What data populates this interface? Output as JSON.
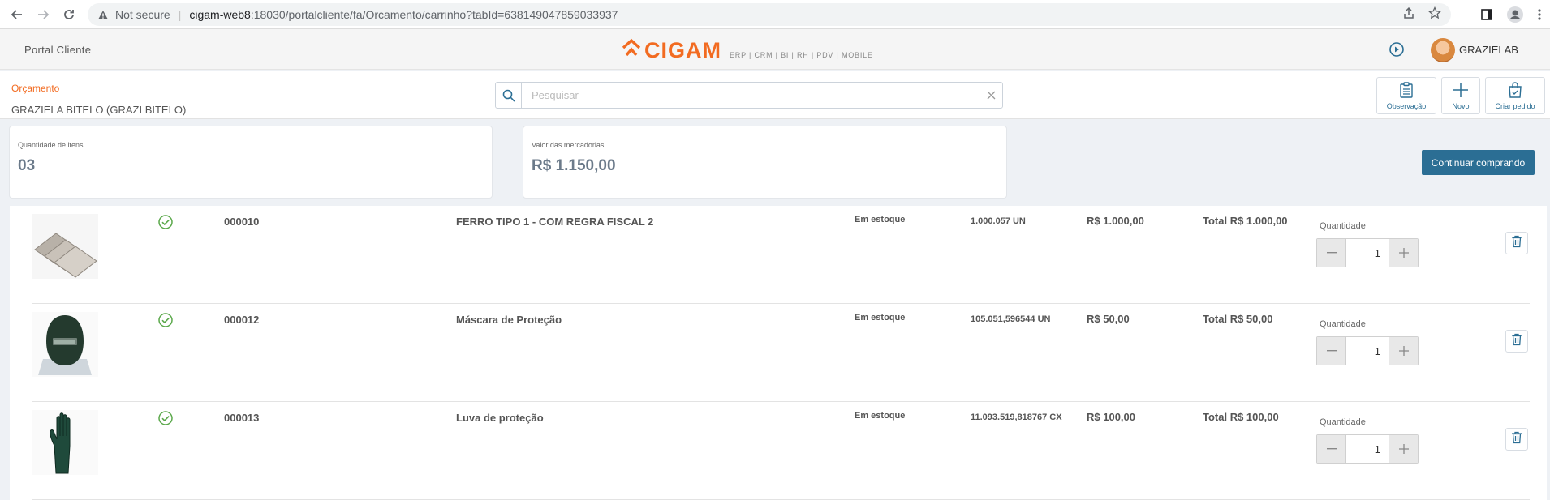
{
  "browser": {
    "security_label": "Not secure",
    "url_host": "cigam-web8",
    "url_rest": ":18030/portalcliente/fa/Orcamento/carrinho?tabId=638149047859033937"
  },
  "header": {
    "portal_title": "Portal Cliente",
    "logo_text": "CIGAM",
    "logo_modules": "ERP | CRM | BI | RH | PDV | MOBILE",
    "username": "GRAZIELAB",
    "brand_color": "#f26b21"
  },
  "subheader": {
    "section_label": "Orçamento",
    "customer_name": "GRAZIELA BITELO (GRAZI BITELO)",
    "search_placeholder": "Pesquisar",
    "actions": {
      "observacao": "Observação",
      "novo": "Novo",
      "criar_pedido": "Criar pedido"
    }
  },
  "summary": {
    "quantity_label": "Quantidade de itens",
    "quantity_value": "03",
    "value_label": "Valor das mercadorias",
    "value_value": "R$ 1.150,00",
    "continue_label": "Continuar comprando",
    "accent_color": "#2b6e94"
  },
  "items": [
    {
      "image_icon": "metal-plates-image",
      "status_icon": "check-circle-icon",
      "code": "000010",
      "description": "FERRO TIPO 1 - COM REGRA FISCAL 2",
      "stock_status": "Em estoque",
      "stock_qty": "1.000.057 UN",
      "price": "R$ 1.000,00",
      "total": "Total R$ 1.000,00",
      "qty_label": "Quantidade",
      "qty": "1"
    },
    {
      "image_icon": "welding-mask-image",
      "status_icon": "check-circle-icon",
      "code": "000012",
      "description": "Máscara de Proteção",
      "stock_status": "Em estoque",
      "stock_qty": "105.051,596544 UN",
      "price": "R$ 50,00",
      "total": "Total R$ 50,00",
      "qty_label": "Quantidade",
      "qty": "1"
    },
    {
      "image_icon": "glove-image",
      "status_icon": "check-circle-icon",
      "code": "000013",
      "description": "Luva de proteção",
      "stock_status": "Em estoque",
      "stock_qty": "11.093.519,818767 CX",
      "price": "R$ 100,00",
      "total": "Total R$ 100,00",
      "qty_label": "Quantidade",
      "qty": "1"
    }
  ]
}
